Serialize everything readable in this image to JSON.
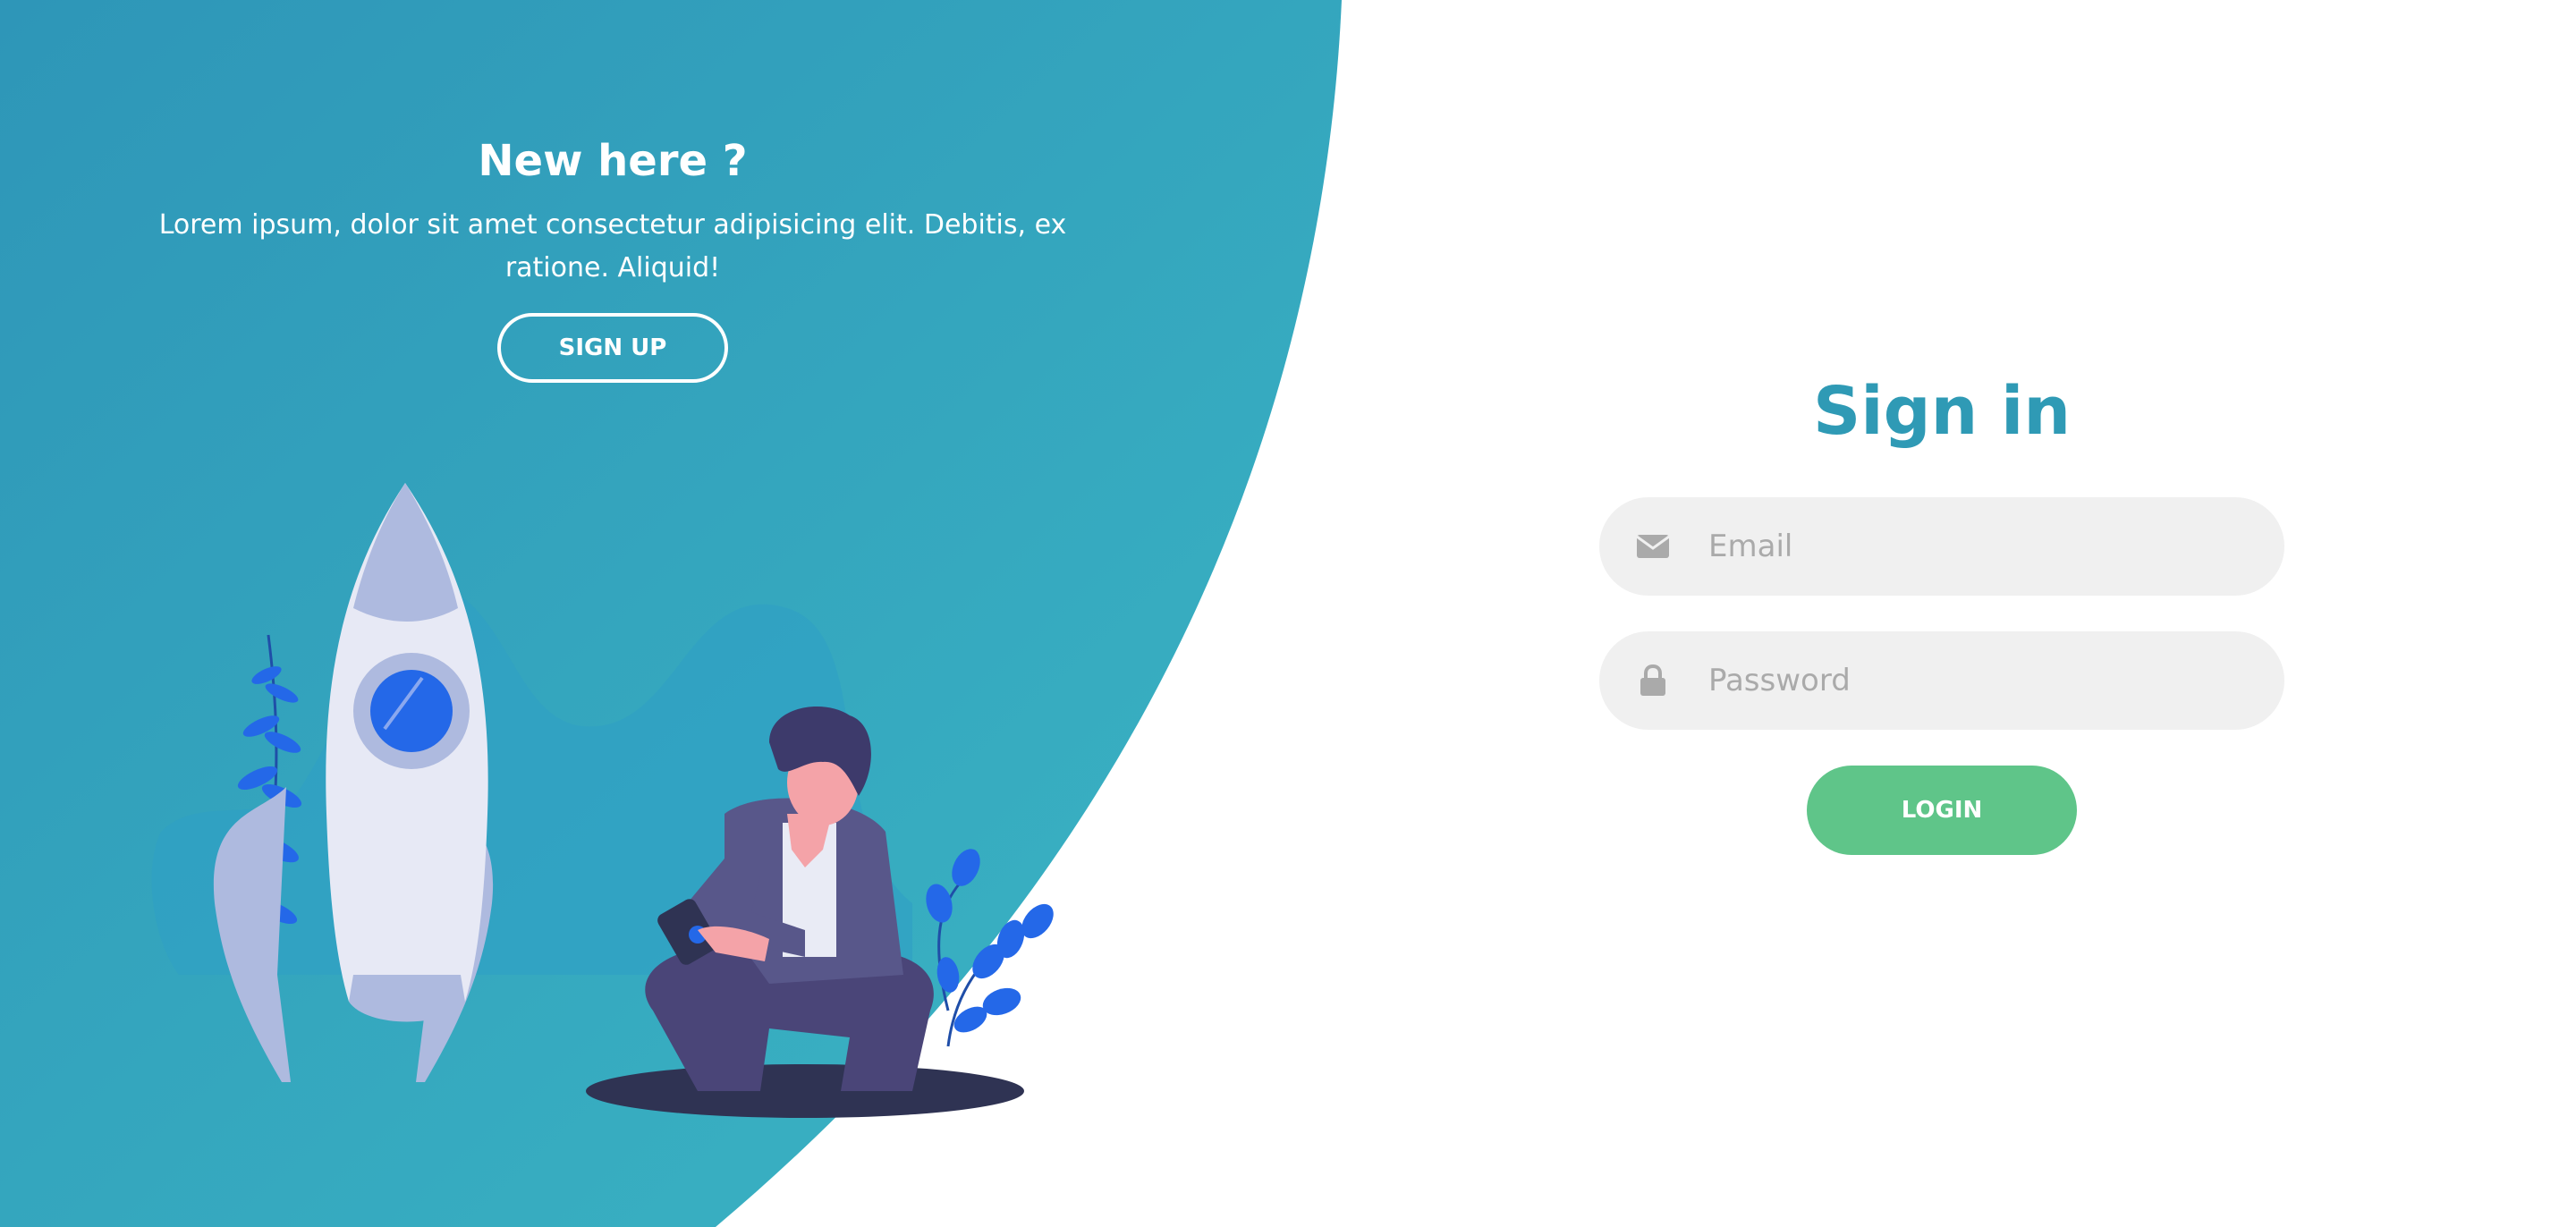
{
  "panel": {
    "title": "New here ?",
    "text": "Lorem ipsum, dolor sit amet consectetur adipisicing elit. Debitis, ex ratione. Aliquid!",
    "signup_label": "SIGN UP"
  },
  "signin": {
    "title": "Sign in",
    "email": {
      "placeholder": "Email",
      "value": "",
      "icon": "envelope-icon"
    },
    "password": {
      "placeholder": "Password",
      "value": "",
      "icon": "lock-icon"
    },
    "login_label": "LOGIN"
  },
  "colors": {
    "panel_gradient_start": "#2e96b8",
    "panel_gradient_end": "#38b2c4",
    "title_accent": "#2f9ab5",
    "input_bg": "#f0f0f0",
    "login_button": "#5fc589"
  }
}
